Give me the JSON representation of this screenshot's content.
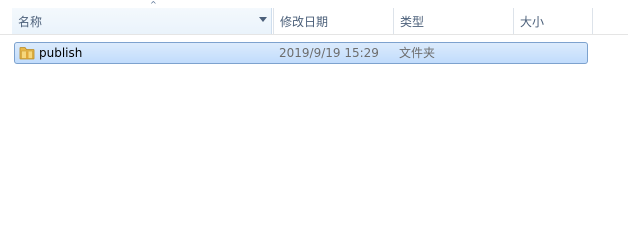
{
  "columns": {
    "name": "名称",
    "date_modified": "修改日期",
    "type": "类型",
    "size": "大小"
  },
  "sort": {
    "column": "name",
    "direction": "ascending",
    "glyph": "^"
  },
  "files": [
    {
      "name": "publish",
      "date_modified": "2019/9/19 15:29",
      "type": "文件夹",
      "size": "",
      "icon": "folder-icon",
      "selected": true
    }
  ],
  "colors": {
    "selection_border": "#7da2ce",
    "selection_fill": "#c1dcfc",
    "header_text": "#4c607a",
    "secondary_text": "#6d6d6d"
  }
}
